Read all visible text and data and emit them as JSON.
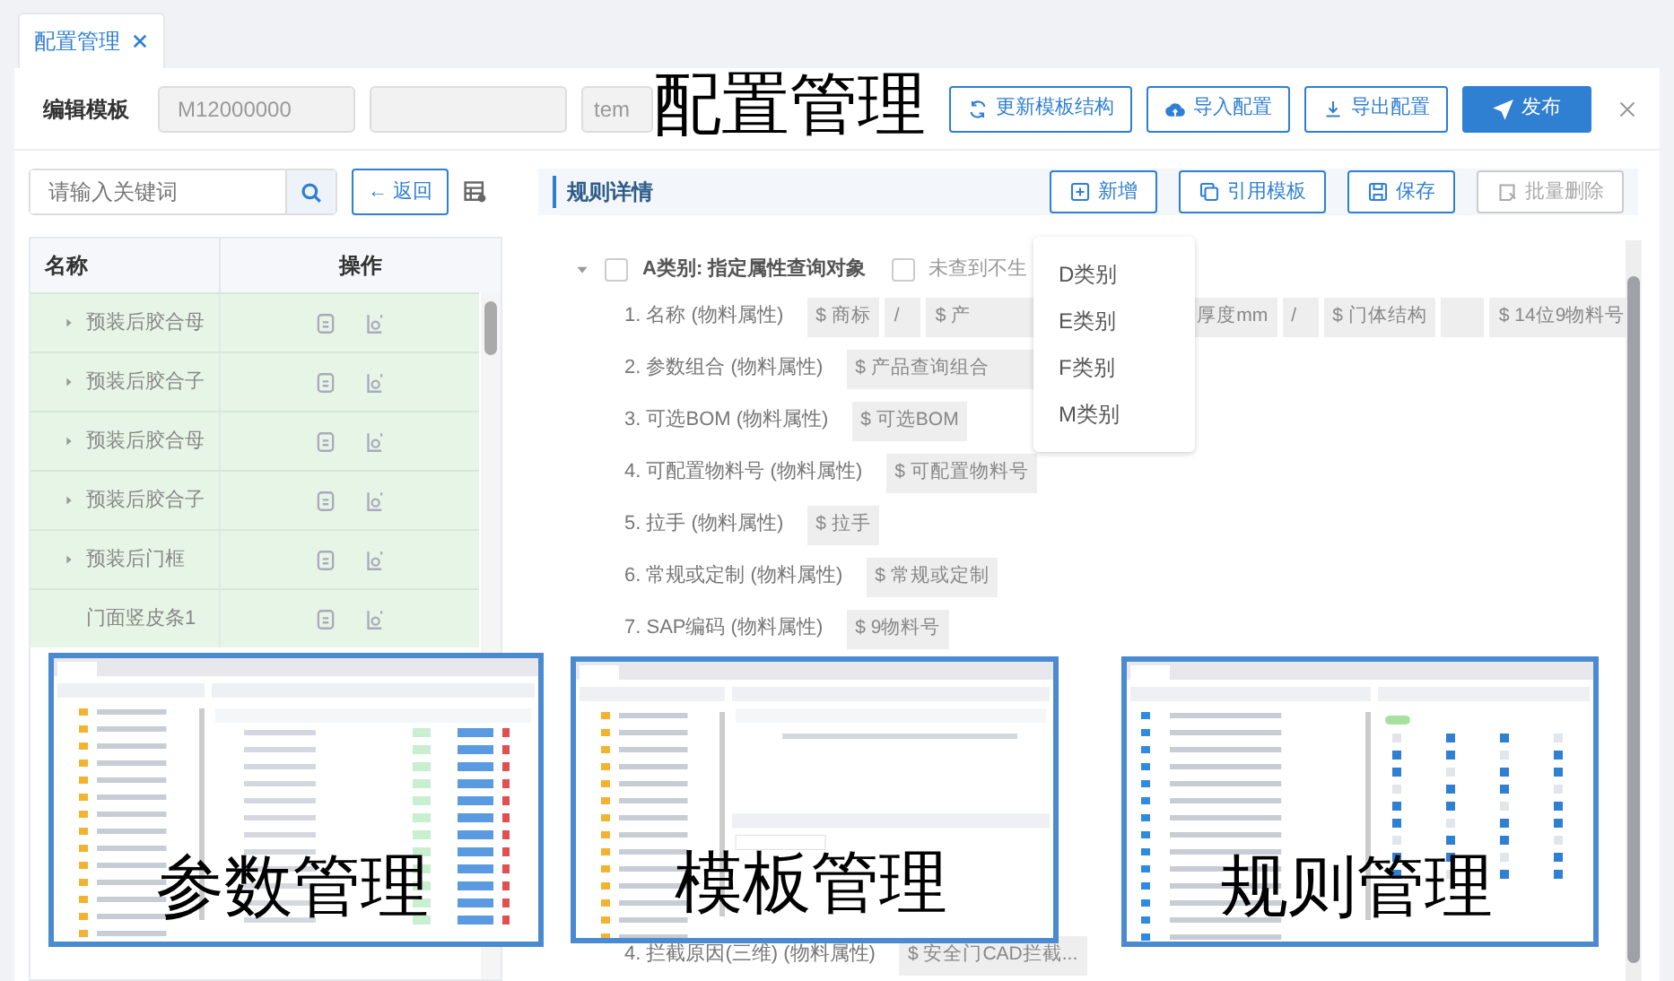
{
  "tab": {
    "label": "配置管理",
    "selected": true
  },
  "overlay_title": "配置管理",
  "toolbar": {
    "label": "编辑模板",
    "fields": [
      {
        "value": "M12000000",
        "disabled": true
      },
      {
        "disabled": true
      },
      {
        "value": "tem",
        "disabled": true
      }
    ],
    "buttons": [
      {
        "label": "更新模板结构",
        "kind": "refresh"
      },
      {
        "label": "导入配置",
        "kind": "upload"
      },
      {
        "label": "导出配置",
        "kind": "download"
      },
      {
        "label": "发布",
        "kind": "publish"
      }
    ]
  },
  "left": {
    "search": {
      "placeholder": "请输入关键词"
    },
    "back": "← 返回",
    "columns": [
      "名称",
      "操作"
    ],
    "rows": [
      {
        "name": "预装后胶合母",
        "expandable": true
      },
      {
        "name": "预装后胶合子",
        "expandable": true
      },
      {
        "name": "预装后胶合母",
        "expandable": true
      },
      {
        "name": "预装后胶合子",
        "expandable": true
      },
      {
        "name": "预装后门框",
        "expandable": true
      },
      {
        "name": "门面竖皮条1",
        "expandable": false
      }
    ]
  },
  "right": {
    "title": "规则详情",
    "buttons": [
      {
        "label": "新增",
        "kind": "add",
        "disabled": false
      },
      {
        "label": "引用模板",
        "kind": "copy",
        "disabled": false
      },
      {
        "label": "保存",
        "kind": "save",
        "disabled": false
      },
      {
        "label": "批量删除",
        "kind": "delete",
        "disabled": true
      }
    ],
    "menu": [
      "D类别",
      "E类别",
      "F类别",
      "M类别"
    ],
    "group": {
      "label": "A类别: 指定属性查询对象",
      "expanded": true,
      "checked": false,
      "option": {
        "label": "未查到不生",
        "checked": false
      }
    },
    "rules": [
      {
        "label": "1. 名称 (物料属性)",
        "chips": [
          {
            "text": "$ 商标"
          },
          {
            "text": "/"
          },
          {
            "text": "$ 产",
            "covered_right": true
          },
          {
            "text": "厚度mm",
            "covered_left": true
          },
          {
            "text": "/"
          },
          {
            "text": "$ 门体结构"
          },
          {
            "kind": "blank"
          },
          {
            "text": "$ 14位9物料号"
          }
        ]
      },
      {
        "label": "2. 参数组合 (物料属性)",
        "chips": [
          {
            "text": "$ 产品查询组合",
            "covered_right": true
          }
        ]
      },
      {
        "label": "3. 可选BOM (物料属性)",
        "chips": [
          {
            "text": "$ 可选BOM"
          }
        ]
      },
      {
        "label": "4. 可配置物料号 (物料属性)",
        "chips": [
          {
            "text": "$ 可配置物料号"
          }
        ]
      },
      {
        "label": "5. 拉手 (物料属性)",
        "chips": [
          {
            "text": "$ 拉手"
          }
        ]
      },
      {
        "label": "6. 常规或定制 (物料属性)",
        "chips": [
          {
            "text": "$ 常规或定制"
          }
        ]
      },
      {
        "label": "7. SAP编码 (物料属性)",
        "chips": [
          {
            "text": "$ 9物料号"
          }
        ]
      }
    ],
    "bottom_rule": {
      "label": "4. 拦截原因(三维) (物料属性)",
      "chips": [
        {
          "text": "$ 安全门CAD拦截..."
        }
      ]
    }
  },
  "previews": [
    {
      "kind": "tree-table",
      "caption": "参数管理"
    },
    {
      "kind": "tree-split",
      "caption": "模板管理"
    },
    {
      "kind": "tree-grid",
      "caption": "规则管理"
    }
  ]
}
